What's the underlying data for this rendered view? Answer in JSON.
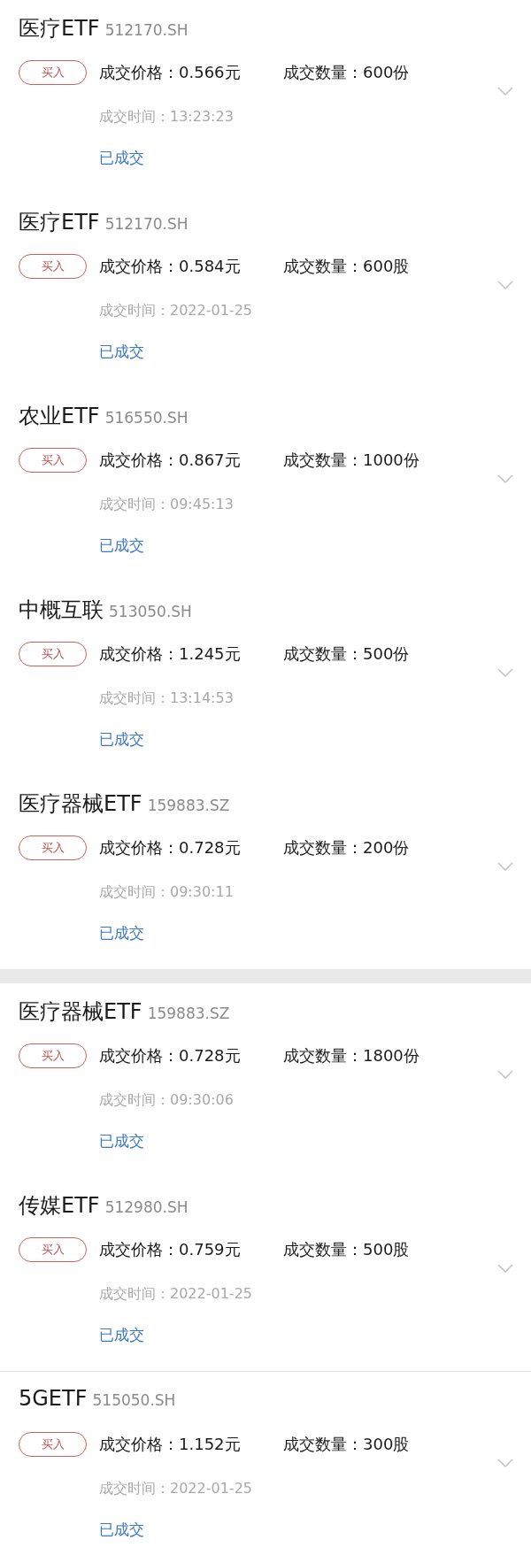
{
  "sections": [
    {
      "trades": [
        {
          "name": "医疗ETF",
          "code": "512170.SH",
          "side": "买入",
          "price": "成交价格：0.566元",
          "quantity": "成交数量：600份",
          "time": "成交时间：13:23:23",
          "status": "已成交",
          "divider_above": false
        },
        {
          "name": "医疗ETF",
          "code": "512170.SH",
          "side": "买入",
          "price": "成交价格：0.584元",
          "quantity": "成交数量：600股",
          "time": "成交时间：2022-01-25",
          "status": "已成交",
          "divider_above": false
        },
        {
          "name": "农业ETF",
          "code": "516550.SH",
          "side": "买入",
          "price": "成交价格：0.867元",
          "quantity": "成交数量：1000份",
          "time": "成交时间：09:45:13",
          "status": "已成交",
          "divider_above": false
        },
        {
          "name": "中概互联",
          "code": "513050.SH",
          "side": "买入",
          "price": "成交价格：1.245元",
          "quantity": "成交数量：500份",
          "time": "成交时间：13:14:53",
          "status": "已成交",
          "divider_above": false
        },
        {
          "name": "医疗器械ETF",
          "code": "159883.SZ",
          "side": "买入",
          "price": "成交价格：0.728元",
          "quantity": "成交数量：200份",
          "time": "成交时间：09:30:11",
          "status": "已成交",
          "divider_above": false
        }
      ]
    },
    {
      "trades": [
        {
          "name": "医疗器械ETF",
          "code": "159883.SZ",
          "side": "买入",
          "price": "成交价格：0.728元",
          "quantity": "成交数量：1800份",
          "time": "成交时间：09:30:06",
          "status": "已成交",
          "divider_above": false
        },
        {
          "name": "传媒ETF",
          "code": "512980.SH",
          "side": "买入",
          "price": "成交价格：0.759元",
          "quantity": "成交数量：500股",
          "time": "成交时间：2022-01-25",
          "status": "已成交",
          "divider_above": false
        },
        {
          "name": "5GETF",
          "code": "515050.SH",
          "side": "买入",
          "price": "成交价格：1.152元",
          "quantity": "成交数量：300股",
          "time": "成交时间：2022-01-25",
          "status": "已成交",
          "divider_above": true
        }
      ]
    }
  ]
}
